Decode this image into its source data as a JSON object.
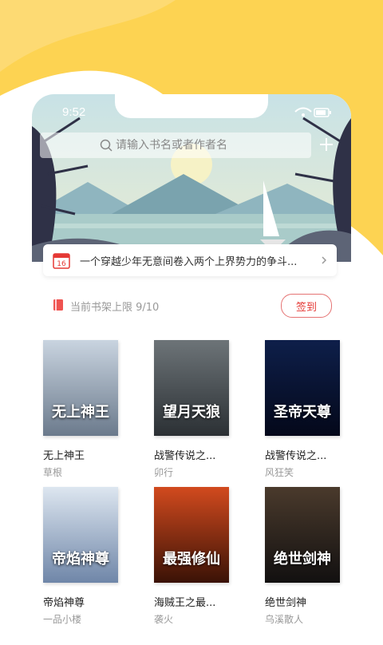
{
  "status_bar": {
    "time": "9:52"
  },
  "search": {
    "placeholder": "请输入书名或者作者名"
  },
  "notice": {
    "text": "一个穿越少年无意间卷入两个上界势力的争斗..."
  },
  "shelf": {
    "limit_text": "当前书架上限 9/10",
    "checkin_label": "签到"
  },
  "books": [
    {
      "title": "无上神王",
      "author": "草根",
      "cover_text": "无上神王",
      "colors": [
        "#c9d4e0",
        "#6b7a8c"
      ]
    },
    {
      "title": "战警传说之...",
      "author": "卯行",
      "cover_text": "望月天狼",
      "colors": [
        "#6d7478",
        "#2b3034"
      ]
    },
    {
      "title": "战警传说之...",
      "author": "风狂笑",
      "cover_text": "圣帝天尊",
      "colors": [
        "#0e1f4a",
        "#04081a"
      ]
    },
    {
      "title": "帝焰神尊",
      "author": "一品小楼",
      "cover_text": "帝焰神尊",
      "colors": [
        "#dde6f0",
        "#6f86a8"
      ]
    },
    {
      "title": "海贼王之最...",
      "author": "袭火",
      "cover_text": "最强修仙",
      "colors": [
        "#d24a1e",
        "#3a1206"
      ]
    },
    {
      "title": "绝世剑神",
      "author": "乌溪散人",
      "cover_text": "绝世剑神",
      "colors": [
        "#4a3a2c",
        "#121010"
      ]
    }
  ],
  "icons": {
    "search": "search-icon",
    "plus": "plus-icon",
    "calendar": "calendar-icon",
    "book": "book-icon",
    "chevron": "chevron-right-icon"
  },
  "colors": {
    "yellow": "#fdd352",
    "accent_red": "#e53935"
  }
}
